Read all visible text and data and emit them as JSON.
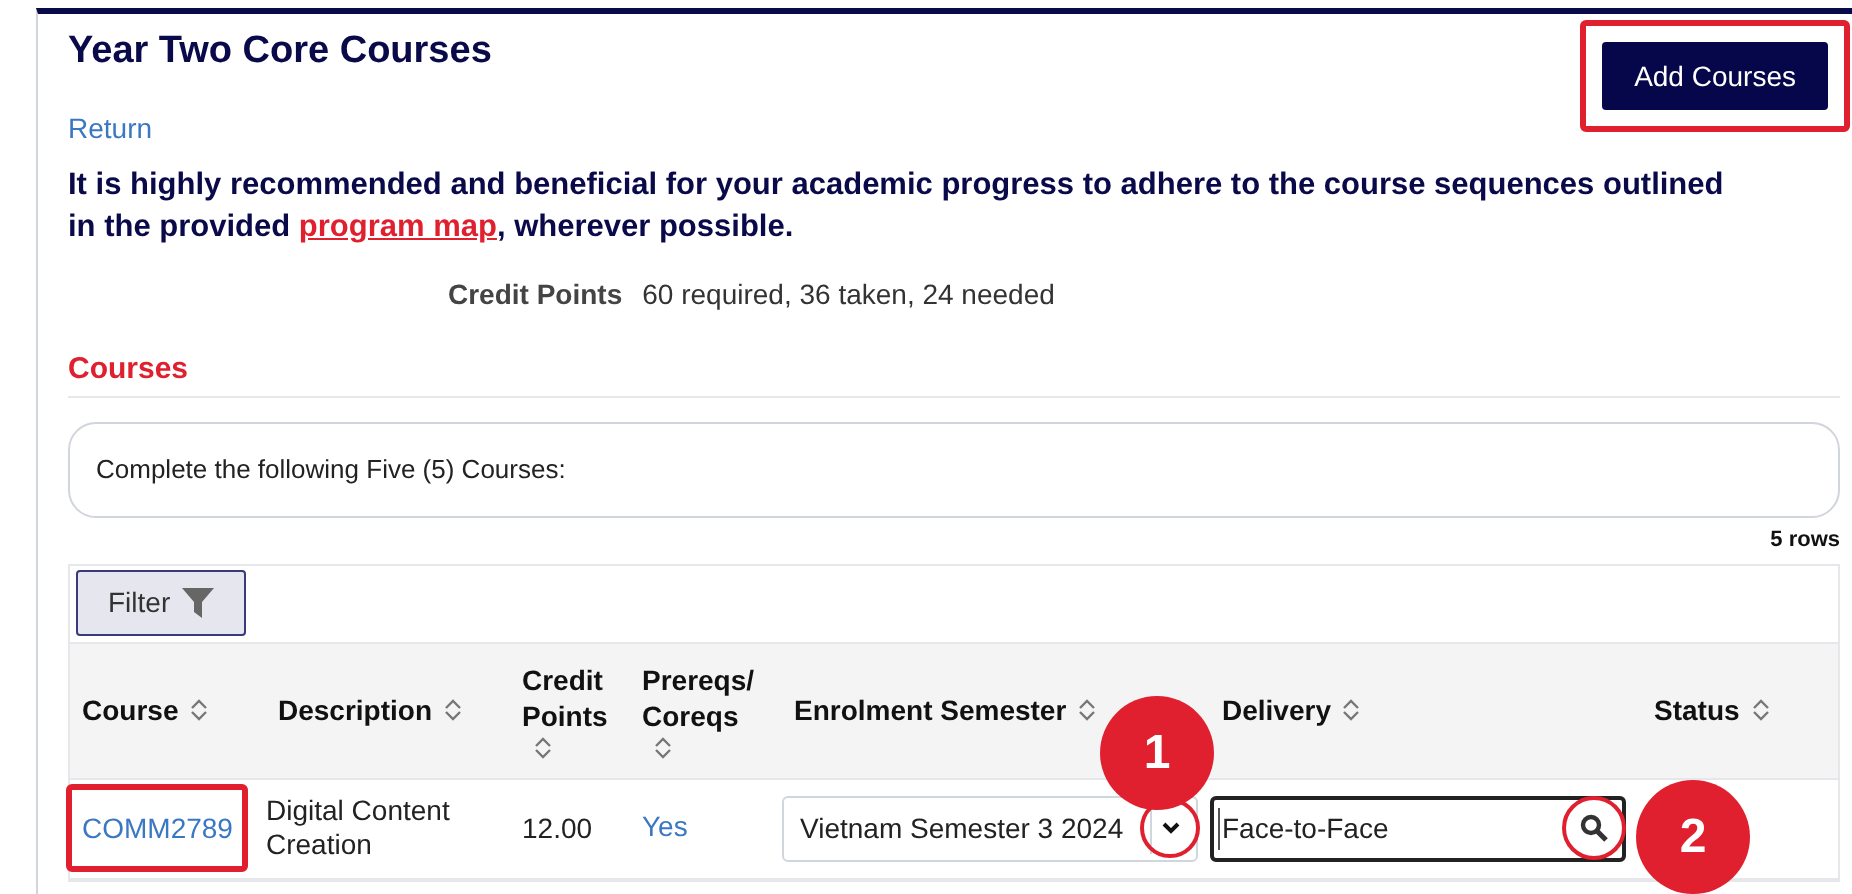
{
  "page": {
    "title": "Year Two Core Courses",
    "return_link": "Return",
    "add_button": {
      "label": "Add Courses",
      "highlighted": true
    },
    "notice": {
      "before": "It is highly recommended and beneficial for your academic progress to adhere to the course sequences outlined in the provided ",
      "link": "program map",
      "after": ", wherever possible."
    },
    "credit_points": {
      "label": "Credit Points",
      "value": "60 required, 36 taken, 24 needed"
    }
  },
  "courses": {
    "heading": "Courses",
    "instruction": "Complete the following Five (5) Courses:",
    "row_count": "5 rows",
    "filter_button": "Filter",
    "columns": [
      {
        "label": "Course",
        "sortable": true
      },
      {
        "label": "Description",
        "sortable": true
      },
      {
        "label": "Credit Points",
        "sortable": true
      },
      {
        "label": "Prereqs/ Coreqs",
        "sortable": true
      },
      {
        "label": "Enrolment Semester",
        "sortable": true
      },
      {
        "label": "Delivery",
        "sortable": true
      },
      {
        "label": "Status",
        "sortable": true
      }
    ],
    "rows": [
      {
        "course": "COMM2789",
        "course_highlighted": true,
        "description": "Digital Content Creation",
        "credit_points": "12.00",
        "prereqs": "Yes",
        "semester": "Vietnam Semester 3 2024",
        "semester_caret_highlighted": true,
        "delivery": "Face-to-Face",
        "delivery_search_highlighted": true
      }
    ]
  },
  "callouts": [
    {
      "label": "1"
    },
    {
      "label": "2"
    }
  ]
}
